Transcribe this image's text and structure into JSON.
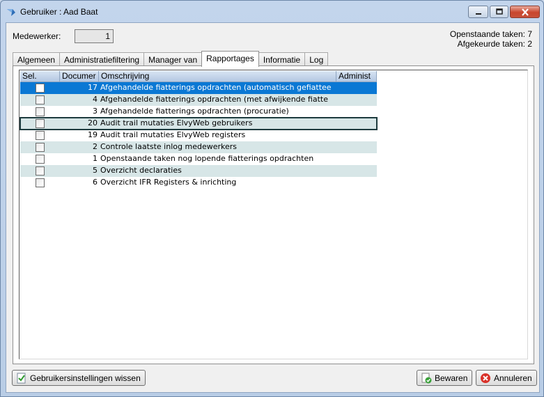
{
  "window": {
    "title": "Gebruiker : Aad Baat"
  },
  "form": {
    "employee_label": "Medewerker:",
    "employee_value": "1",
    "open_tasks": "Openstaande taken: 7",
    "rejected_tasks": "Afgekeurde taken: 2"
  },
  "tabs": [
    {
      "label": "Algemeen"
    },
    {
      "label": "Administratiefiltering"
    },
    {
      "label": "Manager van"
    },
    {
      "label": "Rapportages"
    },
    {
      "label": "Informatie"
    },
    {
      "label": "Log"
    }
  ],
  "active_tab": "Rapportages",
  "grid": {
    "columns": [
      "Sel.",
      "Documer",
      "Omschrijving",
      "Administ"
    ],
    "rows": [
      {
        "checked": false,
        "doc": "17",
        "desc": "Afgehandelde fiatterings opdrachten (automatisch gefiattee",
        "state": "selected"
      },
      {
        "checked": false,
        "doc": "4",
        "desc": "Afgehandelde fiatterings opdrachten (met afwijkende fiatte",
        "state": "alt"
      },
      {
        "checked": false,
        "doc": "3",
        "desc": "Afgehandelde fiatterings opdrachten (procuratie)",
        "state": "normal"
      },
      {
        "checked": false,
        "doc": "20",
        "desc": "Audit trail mutaties ElvyWeb gebruikers",
        "state": "focused"
      },
      {
        "checked": false,
        "doc": "19",
        "desc": "Audit trail mutaties ElvyWeb registers",
        "state": "normal"
      },
      {
        "checked": false,
        "doc": "2",
        "desc": "Controle laatste inlog medewerkers",
        "state": "alt"
      },
      {
        "checked": false,
        "doc": "1",
        "desc": "Openstaande taken nog lopende fiatterings opdrachten",
        "state": "normal"
      },
      {
        "checked": false,
        "doc": "5",
        "desc": "Overzicht declaraties",
        "state": "alt"
      },
      {
        "checked": false,
        "doc": "6",
        "desc": "Overzicht IFR Registers & inrichting",
        "state": "normal"
      }
    ]
  },
  "buttons": {
    "reset_settings": "Gebruikersinstellingen wissen",
    "save": "Bewaren",
    "cancel": "Annuleren"
  },
  "colors": {
    "selected_row": "#0a78d4",
    "alt_row": "#d7e6e7",
    "focus_outline": "#1d3b3e"
  },
  "icons": {
    "app": "app-arrow-icon",
    "reset": "checkmark-document-icon",
    "save": "save-check-icon",
    "cancel": "cancel-x-icon"
  }
}
